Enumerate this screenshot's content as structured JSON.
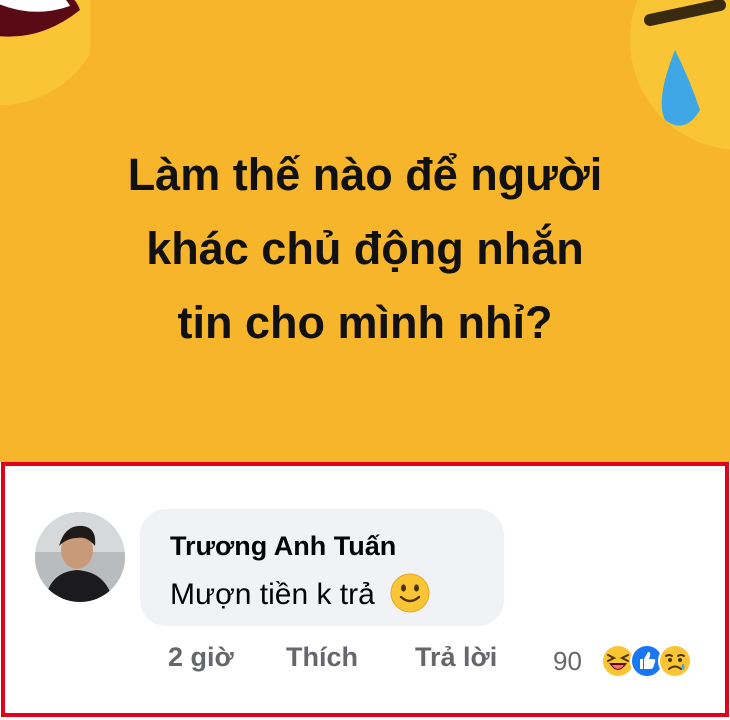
{
  "post": {
    "lines": [
      "Làm thế nào để người",
      "khác chủ động nhắn",
      "tin cho mình nhỉ?"
    ]
  },
  "comment": {
    "author": "Trương Anh Tuấn",
    "text": "Mượn tiền k trả",
    "text_emoji": "slightly-smiling-face-icon",
    "time": "2 giờ",
    "like_label": "Thích",
    "reply_label": "Trả lời",
    "reaction_count": "90",
    "reactions": [
      "haha-icon",
      "like-icon",
      "sad-icon"
    ]
  },
  "colors": {
    "post_background": "#f7b52c",
    "highlight_border": "#e2001a",
    "bubble": "#f0f2f5",
    "meta_text": "#65676b",
    "like_blue": "#1877f2"
  }
}
